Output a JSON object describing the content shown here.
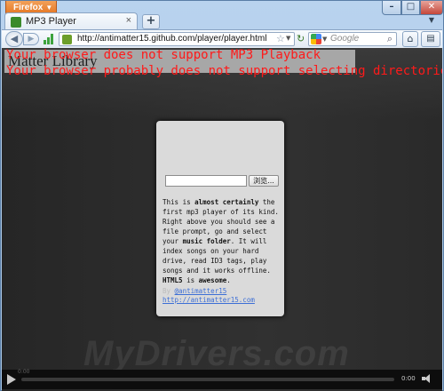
{
  "browser": {
    "menu_label": "Firefox",
    "tab_title": "MP3 Player",
    "new_tab": "+",
    "url": "http://antimatter15.github.com/player/player.html",
    "search_placeholder": "Google",
    "search_icon": "magnifier-icon"
  },
  "page": {
    "errors": [
      "Your browser does not support MP3 Playback",
      "Your browser probably does not support selecting directories"
    ],
    "library_title": "Matter Library",
    "file_button": "浏览...",
    "description_parts": {
      "p1": "This is ",
      "b1": "almost certainly",
      "p2": " the first mp3 player of its kind. Right above you should see a file prompt, go and select your ",
      "b2": "music folder",
      "p3": ". It will index songs on your hard drive, read ID3 tags, play songs and it works offline. ",
      "b3": "HTML5",
      "p4": " is ",
      "b4": "awesome",
      "p5": "."
    },
    "by_label": "By ",
    "author": "@antimatter15",
    "author_site": "http://antimatter15.com",
    "watermark": "MyDrivers.com"
  },
  "audio": {
    "elapsed": "0:00",
    "time": "0:00"
  }
}
